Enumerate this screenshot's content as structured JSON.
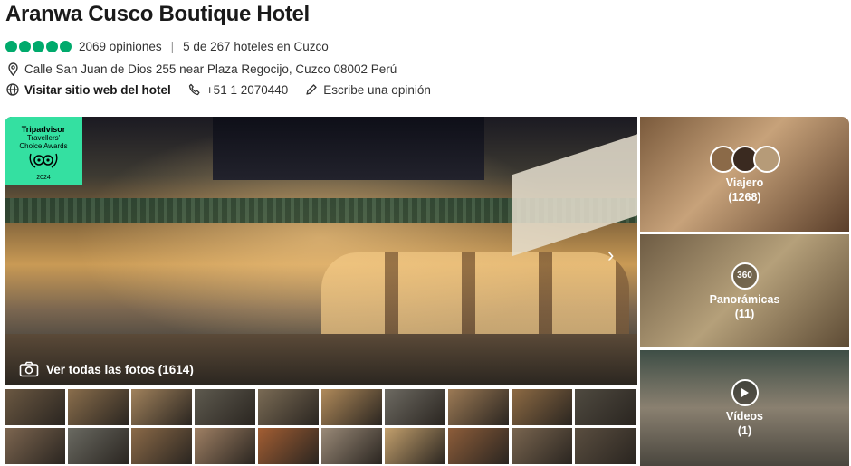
{
  "hotel": {
    "name": "Aranwa Cusco Boutique Hotel",
    "rating_bubbles": 5,
    "reviews": "2069 opiniones",
    "rank": "5 de 267 hoteles en Cuzco",
    "address": "Calle San Juan de Dios 255 near Plaza Regocijo, Cuzco 08002 Perú",
    "website_label": "Visitar sitio web del hotel",
    "phone": "+51 1 2070440",
    "review_label": "Escribe una opinión"
  },
  "badge": {
    "brand": "Tripadvisor",
    "line1": "Travellers'",
    "line2": "Choice Awards",
    "year": "2024"
  },
  "gallery": {
    "all_photos_label": "Ver todas las fotos (1614)",
    "side": [
      {
        "label": "Viajero",
        "count": "(1268)"
      },
      {
        "label": "Panorámicas",
        "count": "(11)",
        "icon_text": "360"
      },
      {
        "label": "Vídeos",
        "count": "(1)"
      }
    ],
    "thumb_colors": [
      "#6b5842",
      "#8a6e4c",
      "#a1825c",
      "#5e5a4f",
      "#7a6b55",
      "#b08a5a",
      "#6d6a62",
      "#9c7a55",
      "#8e6b44",
      "#4f4a40",
      "#7d6650",
      "#6a6a62",
      "#8b6a48",
      "#9f8064",
      "#a35e33",
      "#9a8a78",
      "#c3a06d",
      "#8d5d3a",
      "#7a6650",
      "#5a4e40"
    ]
  }
}
